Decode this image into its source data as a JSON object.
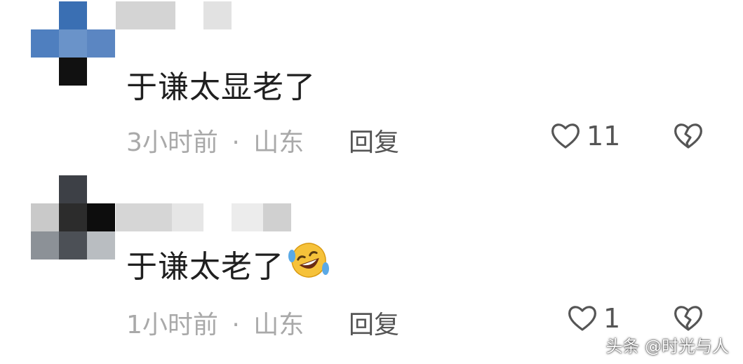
{
  "comments": [
    {
      "text": "于谦太显老了",
      "time": "3小时前",
      "separator": "·",
      "location": "山东",
      "reply_label": "回复",
      "like_count": "11",
      "emoji": ""
    },
    {
      "text": "于谦太老了",
      "time": "1小时前",
      "separator": "·",
      "location": "山东",
      "reply_label": "回复",
      "like_count": "1",
      "emoji": "rolling-laughing-emoji"
    }
  ],
  "watermark": "头条 @时光与人",
  "icons": {
    "like": "heart-outline-icon",
    "dislike": "broken-heart-icon"
  },
  "colors": {
    "text": "#1f1f1f",
    "meta": "#a9a9a9",
    "action": "#555555"
  }
}
